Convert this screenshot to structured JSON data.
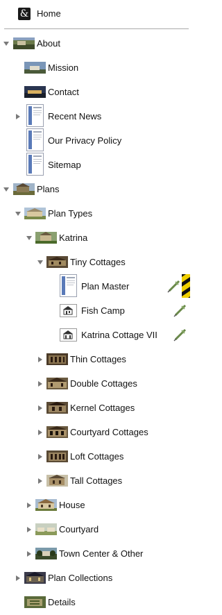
{
  "tree": {
    "home": {
      "label": "Home",
      "icon": "ampersand-icon",
      "glyph": "&"
    },
    "items": [
      {
        "id": "about",
        "label": "About",
        "expanded": true,
        "icon": "photo-thumb",
        "color": "#6b7a4a"
      },
      {
        "id": "mission",
        "label": "Mission",
        "icon": "photo-thumb",
        "color": "#4a6a8a"
      },
      {
        "id": "contact",
        "label": "Contact",
        "icon": "photo-thumb",
        "color": "#2a3550"
      },
      {
        "id": "recent-news",
        "label": "Recent News",
        "expanded": false,
        "icon": "document-icon"
      },
      {
        "id": "privacy-policy",
        "label": "Our Privacy Policy",
        "icon": "document-icon"
      },
      {
        "id": "sitemap",
        "label": "Sitemap",
        "icon": "document-icon"
      },
      {
        "id": "plans",
        "label": "Plans",
        "expanded": true,
        "icon": "photo-thumb",
        "color": "#8a7a55"
      },
      {
        "id": "plan-types",
        "label": "Plan Types",
        "expanded": true,
        "icon": "photo-thumb",
        "color": "#9a8a6a"
      },
      {
        "id": "katrina",
        "label": "Katrina",
        "expanded": true,
        "icon": "photo-thumb",
        "color": "#7a6a4a"
      },
      {
        "id": "tiny-cottages",
        "label": "Tiny Cottages",
        "expanded": true,
        "icon": "photo-thumb",
        "color": "#5a4a35"
      },
      {
        "id": "plan-master",
        "label": "Plan Master",
        "icon": "document-icon",
        "tool": "syringe-icon"
      },
      {
        "id": "fish-camp",
        "label": "Fish Camp",
        "icon": "house-icon",
        "tool": "syringe-icon"
      },
      {
        "id": "katrina-cottage-vii",
        "label": "Katrina Cottage VII",
        "icon": "house-icon",
        "tool": "syringe-icon"
      },
      {
        "id": "thin-cottages",
        "label": "Thin Cottages",
        "expanded": false,
        "icon": "photo-thumb",
        "color": "#5a4a35"
      },
      {
        "id": "double-cottages",
        "label": "Double Cottages",
        "expanded": false,
        "icon": "photo-thumb",
        "color": "#6a5a40"
      },
      {
        "id": "kernel-cottages",
        "label": "Kernel Cottages",
        "expanded": false,
        "icon": "photo-thumb",
        "color": "#5a4a35"
      },
      {
        "id": "courtyard-cottages",
        "label": "Courtyard Cottages",
        "expanded": false,
        "icon": "photo-thumb",
        "color": "#6a5a40"
      },
      {
        "id": "loft-cottages",
        "label": "Loft Cottages",
        "expanded": false,
        "icon": "photo-thumb",
        "color": "#5a4a35"
      },
      {
        "id": "tall-cottages",
        "label": "Tall Cottages",
        "expanded": false,
        "icon": "photo-thumb",
        "color": "#7a6a4a"
      },
      {
        "id": "house",
        "label": "House",
        "expanded": false,
        "icon": "photo-thumb",
        "color": "#8a7a55"
      },
      {
        "id": "courtyard",
        "label": "Courtyard",
        "expanded": false,
        "icon": "photo-thumb",
        "color": "#9a9a6a"
      },
      {
        "id": "town-center",
        "label": "Town Center & Other",
        "expanded": false,
        "icon": "photo-thumb",
        "color": "#4a5a3a"
      },
      {
        "id": "plan-collections",
        "label": "Plan Collections",
        "expanded": false,
        "icon": "photo-thumb",
        "color": "#3a3a4a"
      },
      {
        "id": "details",
        "label": "Details",
        "icon": "photo-thumb",
        "color": "#5a6a3a"
      }
    ]
  },
  "colors": {
    "triangle": "#7a7a7a",
    "divider": "#a9a9a9",
    "syringe": "#7a9a5a"
  }
}
